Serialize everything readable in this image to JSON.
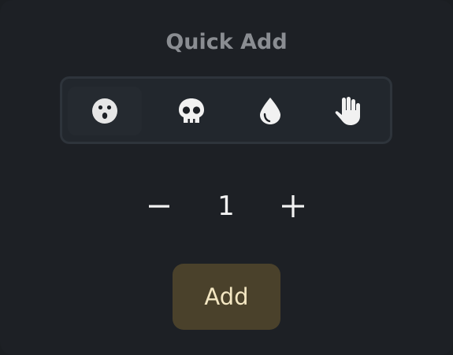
{
  "title": "Quick Add",
  "icons": [
    {
      "name": "surprised-face-icon",
      "selected": true
    },
    {
      "name": "skull-icon",
      "selected": false
    },
    {
      "name": "drop-icon",
      "selected": false
    },
    {
      "name": "hand-icon",
      "selected": false
    }
  ],
  "counter": {
    "decrement_label": "−",
    "value": "1",
    "increment_label": "+"
  },
  "add_button_label": "Add",
  "colors": {
    "background": "#1d2025",
    "icon_bar": "#22272d",
    "add_button_bg": "#4a412b",
    "add_button_text": "#f3e6c2"
  }
}
